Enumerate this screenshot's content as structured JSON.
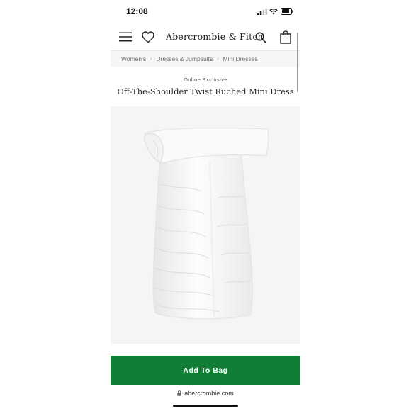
{
  "status_bar": {
    "time": "12:08"
  },
  "header": {
    "brand": "Abercrombie & Fitch",
    "icons": [
      "menu-icon",
      "heart-icon",
      "search-icon",
      "bag-icon"
    ]
  },
  "breadcrumb": {
    "items": [
      "Women's",
      "Dresses & Jumpsuits",
      "Mini Dresses"
    ]
  },
  "product": {
    "eyebrow": "Online Exclusive",
    "title": "Off-The-Shoulder Twist Ruched Mini Dress",
    "image_alt": "White off-the-shoulder twist ruched mini dress"
  },
  "cta": {
    "label": "Add To Bag",
    "color": "#127d35"
  },
  "browser": {
    "url": "abercrombie.com"
  }
}
